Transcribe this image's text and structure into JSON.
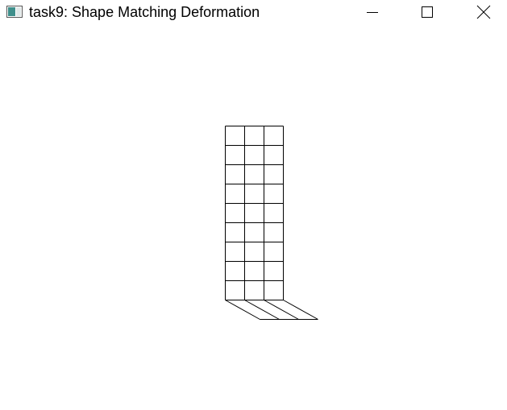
{
  "window": {
    "title": "task9: Shape Matching Deformation"
  },
  "icons": {
    "app": "app-window-icon",
    "minimize": "minimize-icon",
    "maximize": "maximize-icon",
    "close": "close-icon"
  },
  "colors": {
    "background": "#ffffff",
    "mesh_stroke": "#000000",
    "icon_teal": "#3f8f8b",
    "icon_frame": "#555555"
  },
  "mesh": {
    "columns": 3,
    "rows": 9
  }
}
